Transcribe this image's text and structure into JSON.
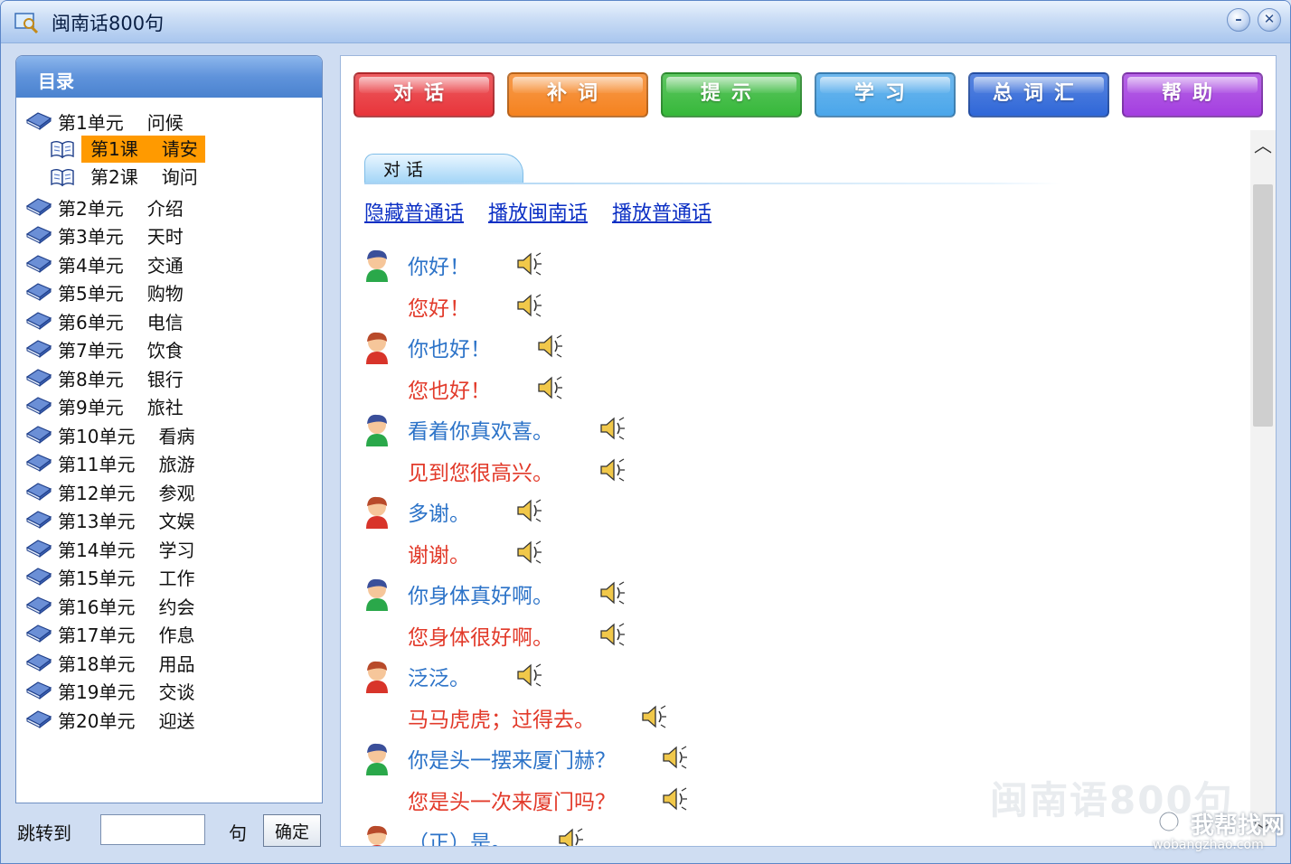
{
  "window": {
    "title": "闽南话800句"
  },
  "sidebar": {
    "title": "目录",
    "units": [
      {
        "label": "第1单元",
        "topic": "问候",
        "lessons": [
          {
            "label": "第1课",
            "topic": "请安",
            "selected": true
          },
          {
            "label": "第2课",
            "topic": "询问",
            "selected": false
          }
        ]
      },
      {
        "label": "第2单元",
        "topic": "介绍"
      },
      {
        "label": "第3单元",
        "topic": "天时"
      },
      {
        "label": "第4单元",
        "topic": "交通"
      },
      {
        "label": "第5单元",
        "topic": "购物"
      },
      {
        "label": "第6单元",
        "topic": "电信"
      },
      {
        "label": "第7单元",
        "topic": "饮食"
      },
      {
        "label": "第8单元",
        "topic": "银行"
      },
      {
        "label": "第9单元",
        "topic": "旅社"
      },
      {
        "label": "第10单元",
        "topic": "看病"
      },
      {
        "label": "第11单元",
        "topic": "旅游"
      },
      {
        "label": "第12单元",
        "topic": "参观"
      },
      {
        "label": "第13单元",
        "topic": "文娱"
      },
      {
        "label": "第14单元",
        "topic": "学习"
      },
      {
        "label": "第15单元",
        "topic": "工作"
      },
      {
        "label": "第16单元",
        "topic": "约会"
      },
      {
        "label": "第17单元",
        "topic": "作息"
      },
      {
        "label": "第18单元",
        "topic": "用品"
      },
      {
        "label": "第19单元",
        "topic": "交谈"
      },
      {
        "label": "第20单元",
        "topic": "迎送"
      }
    ],
    "jump": {
      "label": "跳转到",
      "value": "",
      "unit": "句",
      "button": "确定"
    }
  },
  "toolbar": [
    {
      "label": "对话",
      "color": "#e8343a"
    },
    {
      "label": "补词",
      "color": "#f5821f"
    },
    {
      "label": "提示",
      "color": "#36b83a"
    },
    {
      "label": "学习",
      "color": "#4aa6ea"
    },
    {
      "label": "总词汇",
      "color": "#2f67d8"
    },
    {
      "label": "帮助",
      "color": "#a43ee0"
    }
  ],
  "content": {
    "tab": "对 话",
    "links": [
      "隐藏普通话",
      "播放闽南话",
      "播放普通话"
    ],
    "dialogs": [
      {
        "speaker": "male-blue",
        "minnan": "你好！",
        "mandarin": "您好！"
      },
      {
        "speaker": "male-red",
        "minnan": "你也好！",
        "mandarin": "您也好！"
      },
      {
        "speaker": "male-blue",
        "minnan": "看着你真欢喜。",
        "mandarin": "见到您很高兴。"
      },
      {
        "speaker": "male-red",
        "minnan": "多谢。",
        "mandarin": "谢谢。"
      },
      {
        "speaker": "male-blue",
        "minnan": "你身体真好啊。",
        "mandarin": "您身体很好啊。"
      },
      {
        "speaker": "male-red",
        "minnan": "泛泛。",
        "mandarin": "马马虎虎；过得去。"
      },
      {
        "speaker": "male-blue",
        "minnan": "你是头一摆来厦门赫？",
        "mandarin": "您是头一次来厦门吗？"
      },
      {
        "speaker": "male-red",
        "minnan": "（正）是。",
        "mandarin": ""
      }
    ],
    "watermark": "闽南语800句"
  },
  "overlay_logo": {
    "name": "我帮找网",
    "url": "wobangzhao.com"
  }
}
